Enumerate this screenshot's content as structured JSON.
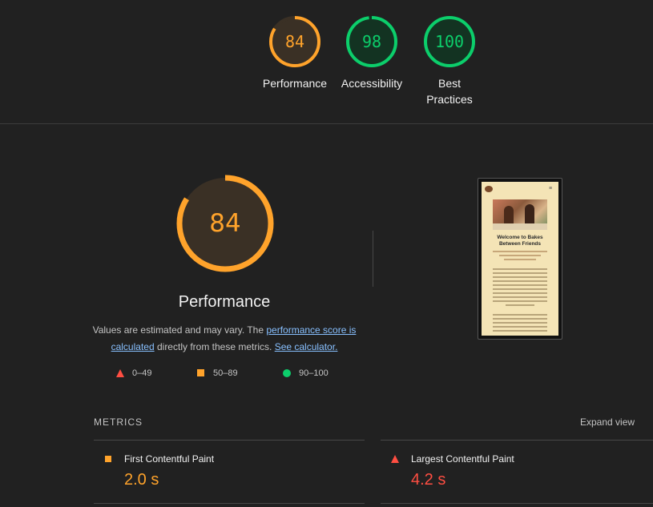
{
  "top_gauges": [
    {
      "score": "84",
      "label": "Performance",
      "color": "#ffa32b",
      "fraction": 0.84
    },
    {
      "score": "98",
      "label": "Accessibility",
      "color": "#0cce6b",
      "fraction": 0.98
    },
    {
      "score": "100",
      "label_line1": "Best",
      "label_line2": "Practices",
      "color": "#0cce6b",
      "fraction": 1.0
    }
  ],
  "main_gauge": {
    "score": "84",
    "fraction": 0.84,
    "color": "#ffa32b"
  },
  "section_title": "Performance",
  "description": {
    "prefix": "Values are estimated and may vary. The ",
    "link1": "performance score is calculated",
    "middle": " directly from these metrics. ",
    "link2": "See calculator."
  },
  "legend": [
    {
      "range": "0–49",
      "color": "#ff4e42",
      "shape": "triangle"
    },
    {
      "range": "50–89",
      "color": "#ffa32b",
      "shape": "square"
    },
    {
      "range": "90–100",
      "color": "#0cce6b",
      "shape": "circle"
    }
  ],
  "metrics_header": {
    "title": "METRICS",
    "expand_label": "Expand view"
  },
  "metrics": [
    {
      "name": "First Contentful Paint",
      "value": "2.0 s",
      "color": "#ffa32b",
      "shape": "square"
    },
    {
      "name": "Largest Contentful Paint",
      "value": "4.2 s",
      "color": "#ff4e42",
      "shape": "triangle"
    }
  ],
  "screenshot": {
    "heading_line1": "Welcome to Bakes",
    "heading_line2": "Between Friends"
  }
}
